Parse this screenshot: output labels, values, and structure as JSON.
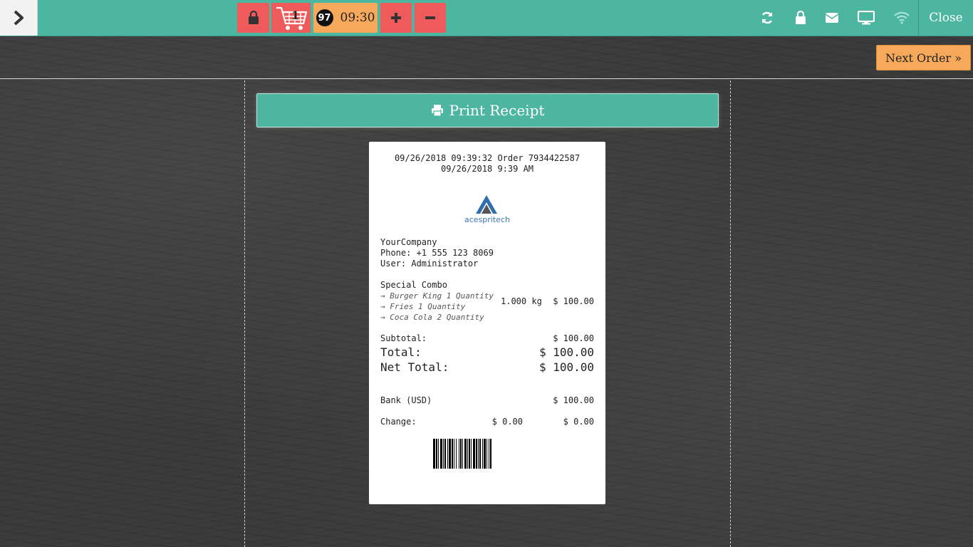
{
  "topbar": {
    "menu_icon": "chevron-right-icon",
    "lock_icon": "lock-icon",
    "cart_icon": "cart-icon",
    "cart_count": "1",
    "order_number": "97",
    "order_time": "09:30",
    "plus_icon": "plus-icon",
    "minus_icon": "minus-icon",
    "right_icons": [
      "refresh-icon",
      "lock-icon",
      "envelope-icon",
      "desktop-icon",
      "wifi-icon"
    ],
    "close_label": "Close"
  },
  "next_order_label": "Next Order »",
  "print_receipt_label": "Print Receipt",
  "receipt": {
    "header_line1": "09/26/2018 09:39:32 Order 7934422587",
    "header_line2": "09/26/2018 9:39 AM",
    "logo_text": "acespritech",
    "company": "YourCompany",
    "phone": "Phone: +1 555 123 8069",
    "user": "User: Administrator",
    "item_name": "Special Combo",
    "sub_items": [
      "→ Burger King 1 Quantity",
      "→ Fries 1 Quantity",
      "→ Coca Cola 2 Quantity"
    ],
    "item_qty": "1.000 kg",
    "item_price": "$ 100.00",
    "subtotal_label": "Subtotal:",
    "subtotal_value": "$ 100.00",
    "total_label": "Total:",
    "total_value": "$ 100.00",
    "net_total_label": "Net Total:",
    "net_total_value": "$ 100.00",
    "payment_label": "Bank (USD)",
    "payment_value": "$ 100.00",
    "change_label": "Change:",
    "change_value1": "$ 0.00",
    "change_value2": "$ 0.00"
  },
  "colors": {
    "teal": "#4db6a0",
    "red": "#ef5b5b",
    "orange": "#f6a95a"
  }
}
